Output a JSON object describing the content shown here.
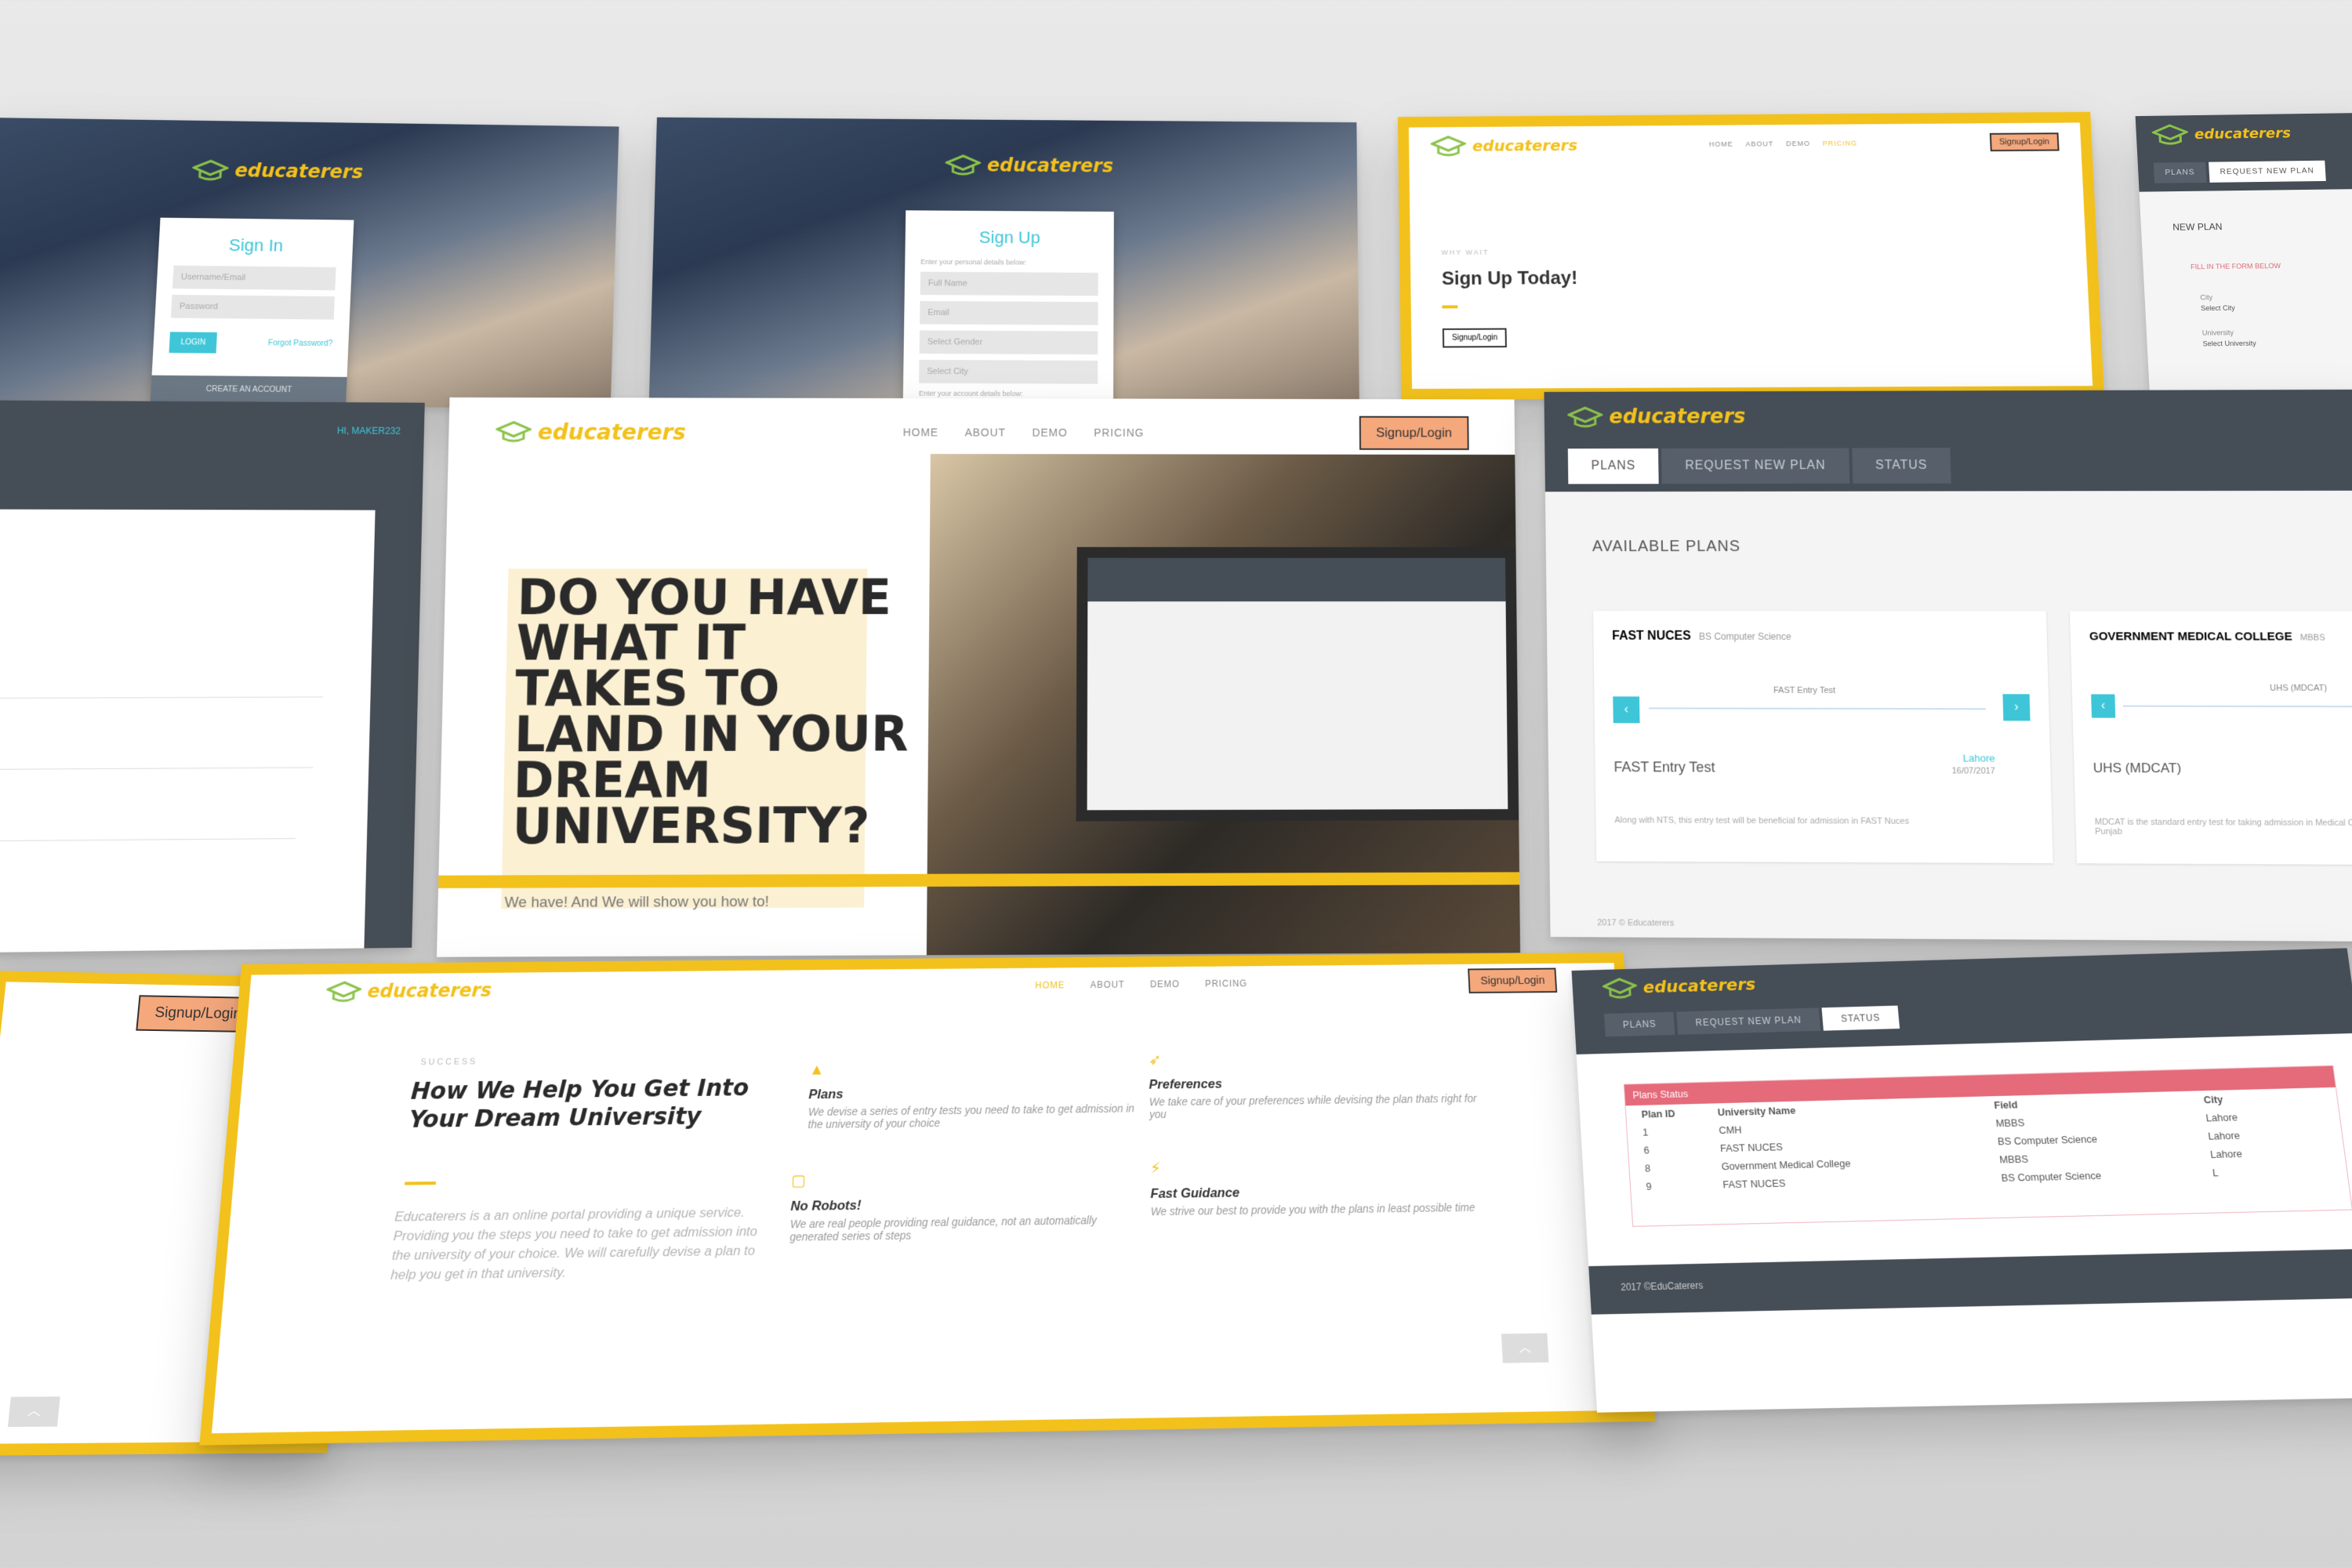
{
  "brand": {
    "name": "educaterers",
    "accent": "#f3c11b",
    "cta_color": "#f5a87c",
    "teal": "#3ec6d8",
    "dark": "#454d56"
  },
  "nav": {
    "home": "HOME",
    "about": "ABOUT",
    "demo": "DEMO",
    "pricing": "PRICING",
    "cta": "Signup/Login"
  },
  "signin": {
    "title": "Sign In",
    "username_placeholder": "Username/Email",
    "password_placeholder": "Password",
    "login": "LOGIN",
    "forgot": "Forgot Password?",
    "create": "CREATE AN ACCOUNT"
  },
  "signup": {
    "title": "Sign Up",
    "intro": "Enter your personal details below:",
    "full_name": "Full Name",
    "email": "Email",
    "gender": "Select Gender",
    "city": "Select City",
    "account": "Enter your account details below:"
  },
  "signup_today": {
    "kicker": "WHY WAIT",
    "title": "Sign Up Today!",
    "button": "Signup/Login"
  },
  "request_plan": {
    "tab_plans": "PLANS",
    "tab_request": "REQUEST NEW PLAN",
    "heading": "NEW PLAN",
    "alert": "FILL IN THE FORM BELOW",
    "city_label": "City",
    "city_value": "Select City",
    "uni_label": "University",
    "uni_value": "Select University"
  },
  "left_dash": {
    "user": "HI, MAKER232"
  },
  "hero": {
    "title": "DO YOU HAVE WHAT IT TAKES TO LAND IN YOUR DREAM UNIVERSITY?",
    "subtitle": "We have! And We will show you how to!"
  },
  "plans": {
    "tabs": [
      "PLANS",
      "REQUEST NEW PLAN",
      "STATUS"
    ],
    "heading": "AVAILABLE PLANS",
    "card1": {
      "uni": "FAST NUCES",
      "field": "BS Computer Science",
      "step": "FAST Entry Test",
      "test": "FAST Entry Test",
      "city": "Lahore",
      "date": "16/07/2017",
      "desc": "Along with NTS, this entry test will be beneficial for admission in FAST Nuces"
    },
    "card2": {
      "uni": "GOVERNMENT MEDICAL COLLEGE",
      "field": "MBBS",
      "step": "UHS (MDCAT)",
      "test": "UHS (MDCAT)",
      "desc": "MDCAT is the standard entry test for taking admission in Medical College in Punjab"
    },
    "footer": "2017 © Educaterers"
  },
  "help": {
    "kicker": "SUCCESS",
    "title": "How We Help You Get Into Your Dream University",
    "body": "Educaterers is a an online portal providing a unique service. Providing you the steps you need to take to get admission into the university of your choice. We will carefully devise a plan to help you get in that university.",
    "features": [
      {
        "icon": "pyramid-icon",
        "title": "Plans",
        "text": "We devise a series of entry tests you need to take to get admission in the university of your choice"
      },
      {
        "icon": "rocket-icon",
        "title": "Preferences",
        "text": "We take care of your preferences while devising the plan thats right for you"
      },
      {
        "icon": "square-icon",
        "title": "No Robots!",
        "text": "We are real people providing real guidance, not an automatically generated series of steps"
      },
      {
        "icon": "bolt-icon",
        "title": "Fast Guidance",
        "text": "We strive our best to provide you with the plans in least possible time"
      }
    ]
  },
  "status": {
    "tabs": [
      "PLANS",
      "REQUEST NEW PLAN",
      "STATUS"
    ],
    "table_title": "Plans Status",
    "columns": [
      "Plan ID",
      "University Name",
      "Field",
      "City"
    ],
    "rows": [
      [
        "1",
        "CMH",
        "MBBS",
        "Lahore"
      ],
      [
        "6",
        "FAST NUCES",
        "BS Computer Science",
        "Lahore"
      ],
      [
        "8",
        "Government Medical College",
        "MBBS",
        "Lahore"
      ],
      [
        "9",
        "FAST NUCES",
        "BS Computer Science",
        "L"
      ]
    ],
    "footer": "2017 ©EduCaterers"
  }
}
